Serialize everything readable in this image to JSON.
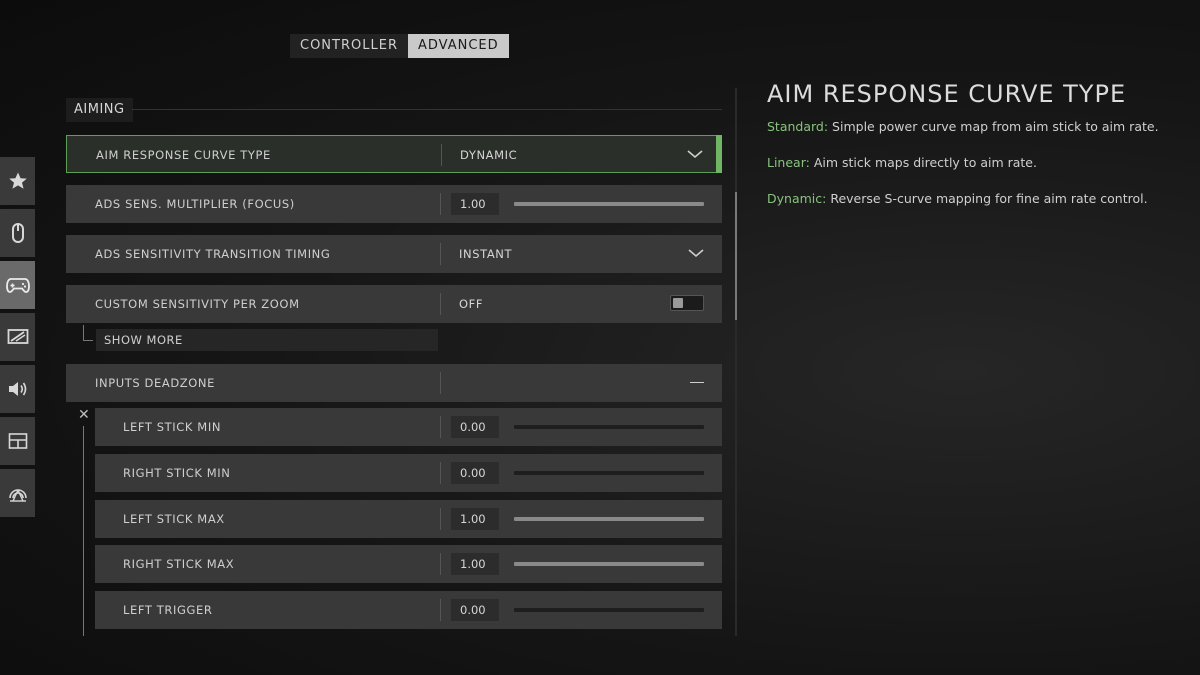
{
  "tabs": [
    {
      "label": "CONTROLLER",
      "active": false
    },
    {
      "label": "ADVANCED",
      "active": true
    }
  ],
  "nav": [
    {
      "icon": "star-icon",
      "active": false
    },
    {
      "icon": "mouse-icon",
      "active": false
    },
    {
      "icon": "gamepad-icon",
      "active": true
    },
    {
      "icon": "display-icon",
      "active": false
    },
    {
      "icon": "speaker-icon",
      "active": false
    },
    {
      "icon": "interface-layout-icon",
      "active": false
    },
    {
      "icon": "network-icon",
      "active": false
    }
  ],
  "section": {
    "label": "AIMING"
  },
  "rows": {
    "aim_response_curve": {
      "label": "AIM RESPONSE CURVE TYPE",
      "value": "DYNAMIC"
    },
    "ads_sens_multiplier": {
      "label": "ADS SENS. MULTIPLIER (FOCUS)",
      "value": "1.00",
      "level": 1.0
    },
    "ads_transition": {
      "label": "ADS SENSITIVITY TRANSITION TIMING",
      "value": "INSTANT"
    },
    "custom_sens_zoom": {
      "label": "CUSTOM SENSITIVITY PER ZOOM",
      "value": "OFF"
    },
    "show_more": {
      "label": "SHOW MORE"
    },
    "inputs_deadzone": {
      "label": "INPUTS DEADZONE"
    },
    "left_stick_min": {
      "label": "LEFT STICK MIN",
      "value": "0.00",
      "level": 0.0
    },
    "right_stick_min": {
      "label": "RIGHT STICK MIN",
      "value": "0.00",
      "level": 0.0
    },
    "left_stick_max": {
      "label": "LEFT STICK MAX",
      "value": "1.00",
      "level": 1.0
    },
    "right_stick_max": {
      "label": "RIGHT STICK MAX",
      "value": "1.00",
      "level": 1.0
    },
    "left_trigger": {
      "label": "LEFT TRIGGER",
      "value": "0.00",
      "level": 0.0
    }
  },
  "info": {
    "title": "AIM RESPONSE CURVE TYPE",
    "lines": [
      {
        "term": "Standard:",
        "text": " Simple power curve map from aim stick to aim rate."
      },
      {
        "term": "Linear:",
        "text": " Aim stick maps directly to aim rate."
      },
      {
        "term": "Dynamic:",
        "text": " Reverse S-curve mapping for fine aim rate control."
      }
    ]
  },
  "colors": {
    "accent": "#6fb564",
    "accent_text": "#88c27e",
    "row_bg": "#393939"
  }
}
